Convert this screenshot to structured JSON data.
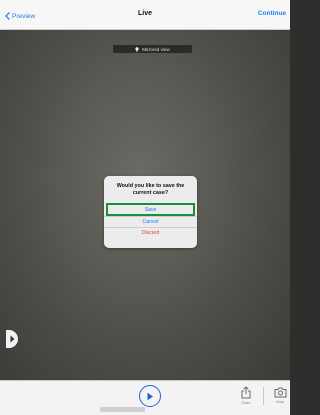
{
  "nav": {
    "back_label": "Preview",
    "title": "Live",
    "action_label": "Continue"
  },
  "camera": {
    "badge_label": "Mirrored view"
  },
  "dialog": {
    "message": "Would you like to save the current case?",
    "buttons": {
      "save": "Save",
      "cancel": "Cancel",
      "discard": "Discard"
    }
  },
  "toolbar": {
    "share_label": "Share",
    "snapshot_label": "Snap"
  },
  "colors": {
    "accent": "#1e7bf2",
    "destructive": "#e0453a",
    "highlight": "#1a8f3a"
  },
  "icons": {
    "back": "chevron-left-icon",
    "bulb": "lightbulb-icon",
    "play": "play-icon",
    "share": "share-icon",
    "snapshot": "camera-icon",
    "handle": "chevron-right-icon"
  }
}
